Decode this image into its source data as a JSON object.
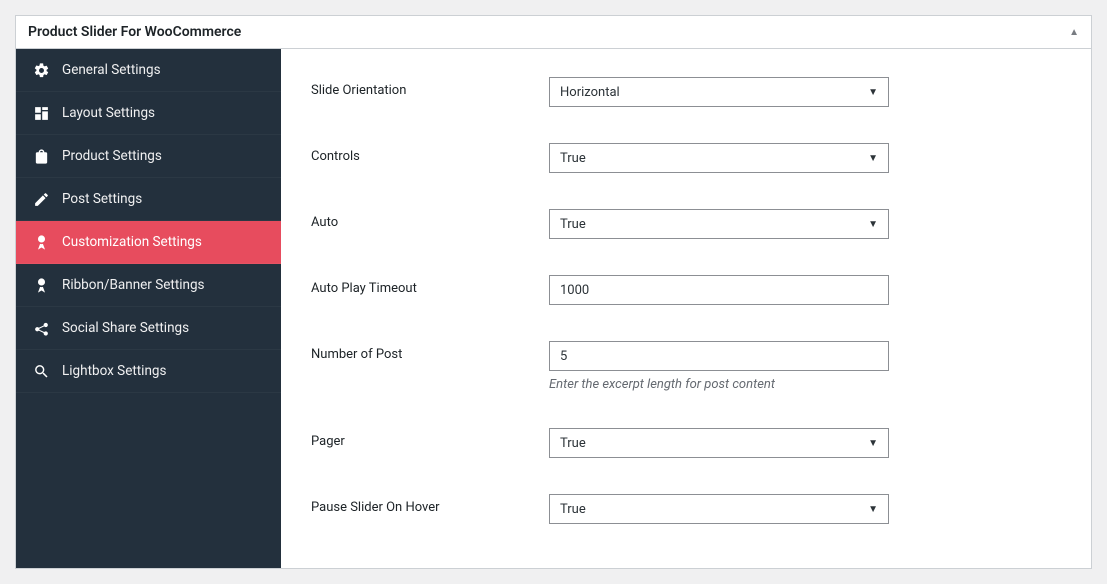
{
  "header": {
    "title": "Product Slider For WooCommerce"
  },
  "sidebar": {
    "items": [
      {
        "label": "General Settings"
      },
      {
        "label": "Layout Settings"
      },
      {
        "label": "Product Settings"
      },
      {
        "label": "Post Settings"
      },
      {
        "label": "Customization Settings"
      },
      {
        "label": "Ribbon/Banner Settings"
      },
      {
        "label": "Social Share Settings"
      },
      {
        "label": "Lightbox Settings"
      }
    ]
  },
  "fields": {
    "slide_orientation": {
      "label": "Slide Orientation",
      "value": "Horizontal"
    },
    "controls": {
      "label": "Controls",
      "value": "True"
    },
    "auto": {
      "label": "Auto",
      "value": "True"
    },
    "auto_play_timeout": {
      "label": "Auto Play Timeout",
      "value": "1000"
    },
    "number_of_post": {
      "label": "Number of Post",
      "value": "5",
      "hint": "Enter the excerpt length for post content"
    },
    "pager": {
      "label": "Pager",
      "value": "True"
    },
    "pause_on_hover": {
      "label": "Pause Slider On Hover",
      "value": "True"
    }
  }
}
